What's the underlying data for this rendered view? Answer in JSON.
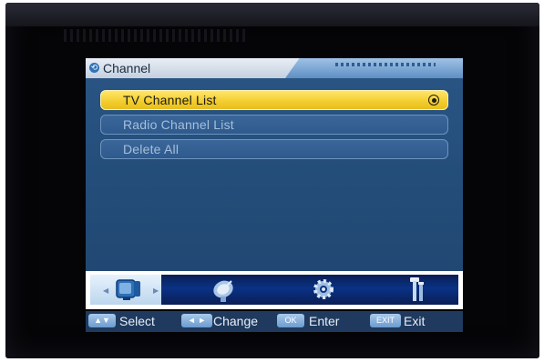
{
  "menu": {
    "title": "Channel",
    "items": [
      {
        "label": "TV Channel List",
        "selected": true
      },
      {
        "label": "Radio Channel List",
        "selected": false
      },
      {
        "label": "Delete All",
        "selected": false
      }
    ]
  },
  "icon_bar": {
    "icons": [
      "tv-icon",
      "satellite-dish-icon",
      "gear-icon",
      "tools-icon"
    ],
    "selected_index": 0
  },
  "help": {
    "select": {
      "key": "▲▼",
      "label": "Select"
    },
    "change": {
      "key": "◄ ►",
      "label": "Change"
    },
    "enter": {
      "key": "OK",
      "label": "Enter"
    },
    "exit": {
      "key": "EXIT",
      "label": "Exit"
    }
  },
  "colors": {
    "panel": "#2a5584",
    "highlight": "#f2cc2c",
    "row_border": "#6f94bf",
    "header": "#e9eef6",
    "icon_track": "#0a3285"
  }
}
